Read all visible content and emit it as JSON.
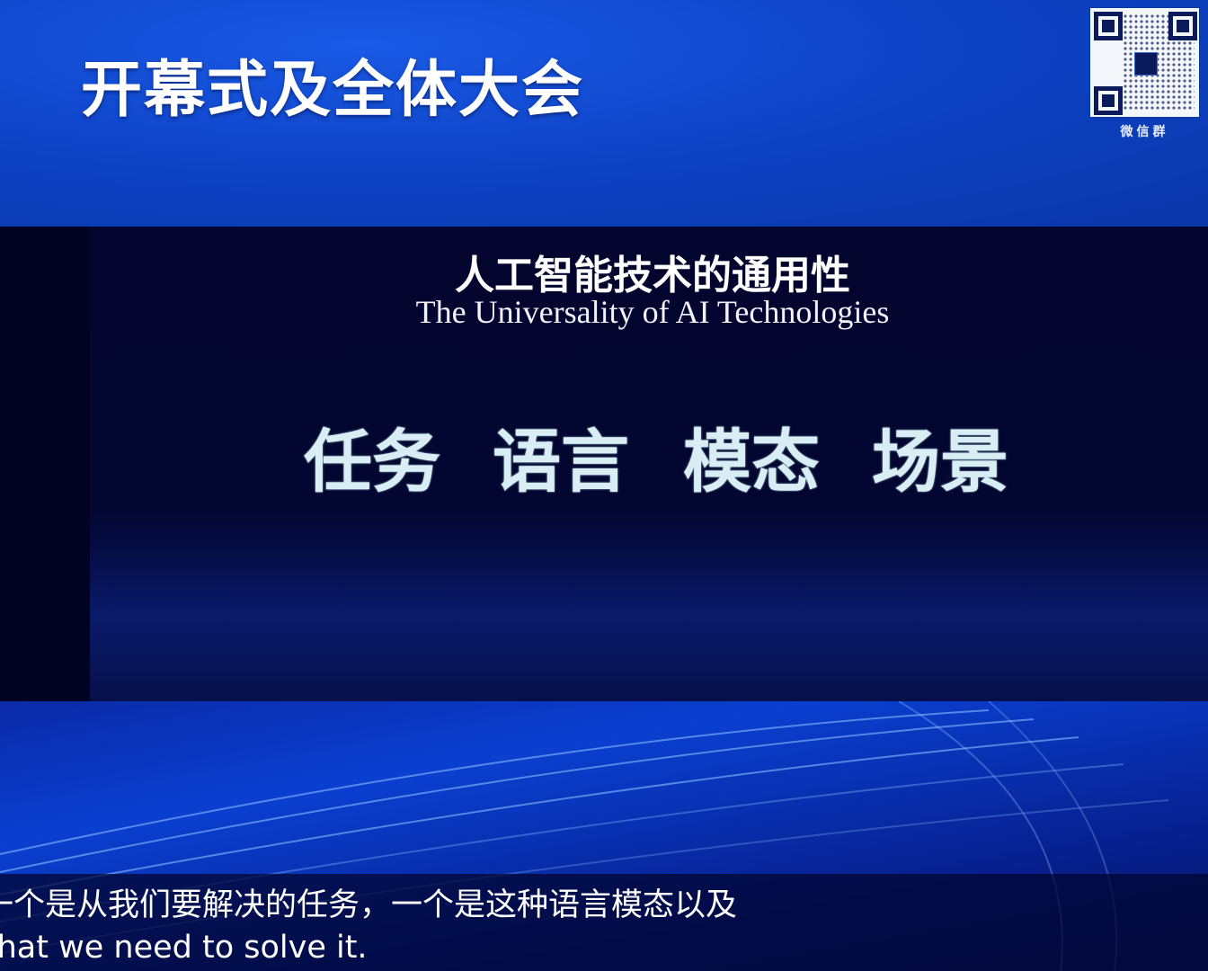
{
  "header": {
    "title": "开幕式及全体大会",
    "qr_label": "微信群"
  },
  "slide": {
    "title_cn": "人工智能技术的通用性",
    "title_en": "The Universality of AI Technologies",
    "keywords": [
      "任务",
      "语言",
      "模态",
      "场景"
    ]
  },
  "subtitles": {
    "line_cn": "一个是从我们要解决的任务，一个是这种语言模态以及",
    "line_en": "what we need to solve it."
  }
}
